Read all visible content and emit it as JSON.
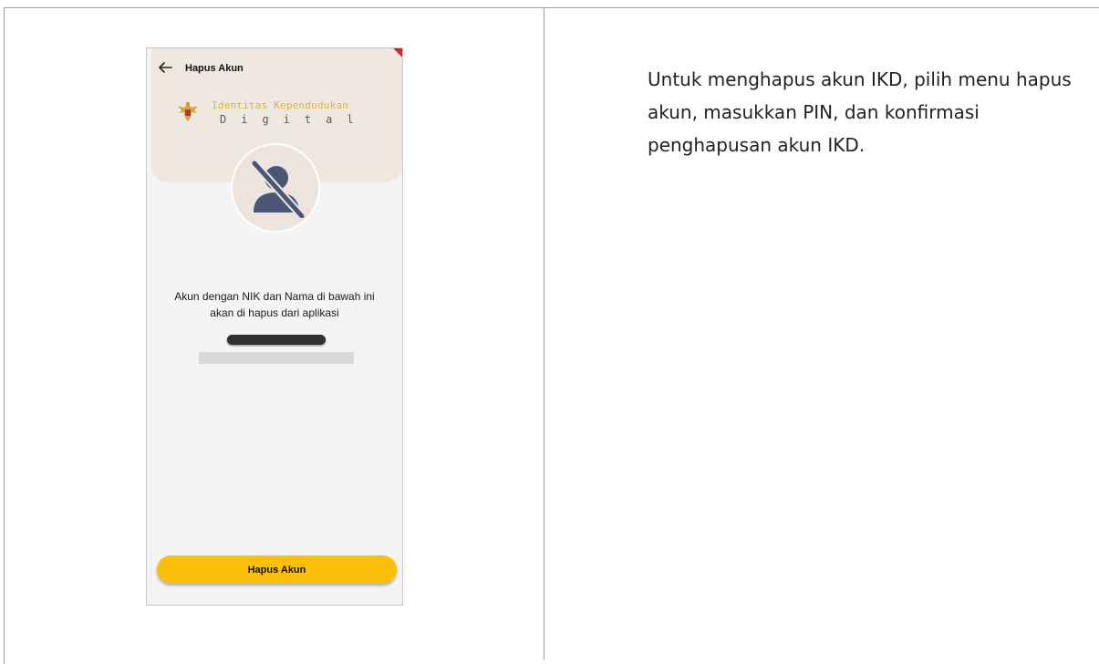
{
  "phone": {
    "title": "Hapus Akun",
    "logo": {
      "line1": "Identitas Kependudukan",
      "line2": "Digital"
    },
    "message_line1": "Akun dengan NIK dan Nama di bawah ini",
    "message_line2": "akan di hapus dari aplikasi",
    "delete_button_label": "Hapus Akun",
    "icons": {
      "back": "arrow-left-icon",
      "avatar": "user-off-icon",
      "emblem": "garuda-emblem-icon"
    },
    "colors": {
      "header_bg": "#efe8e1",
      "accent_yellow": "#fcc00a",
      "avatar_icon": "#4b5677",
      "logo_text": "#e3b23c"
    }
  },
  "instruction_text": "Untuk menghapus akun IKD, pilih menu hapus akun, masukkan PIN, dan konfirmasi penghapusan akun IKD."
}
